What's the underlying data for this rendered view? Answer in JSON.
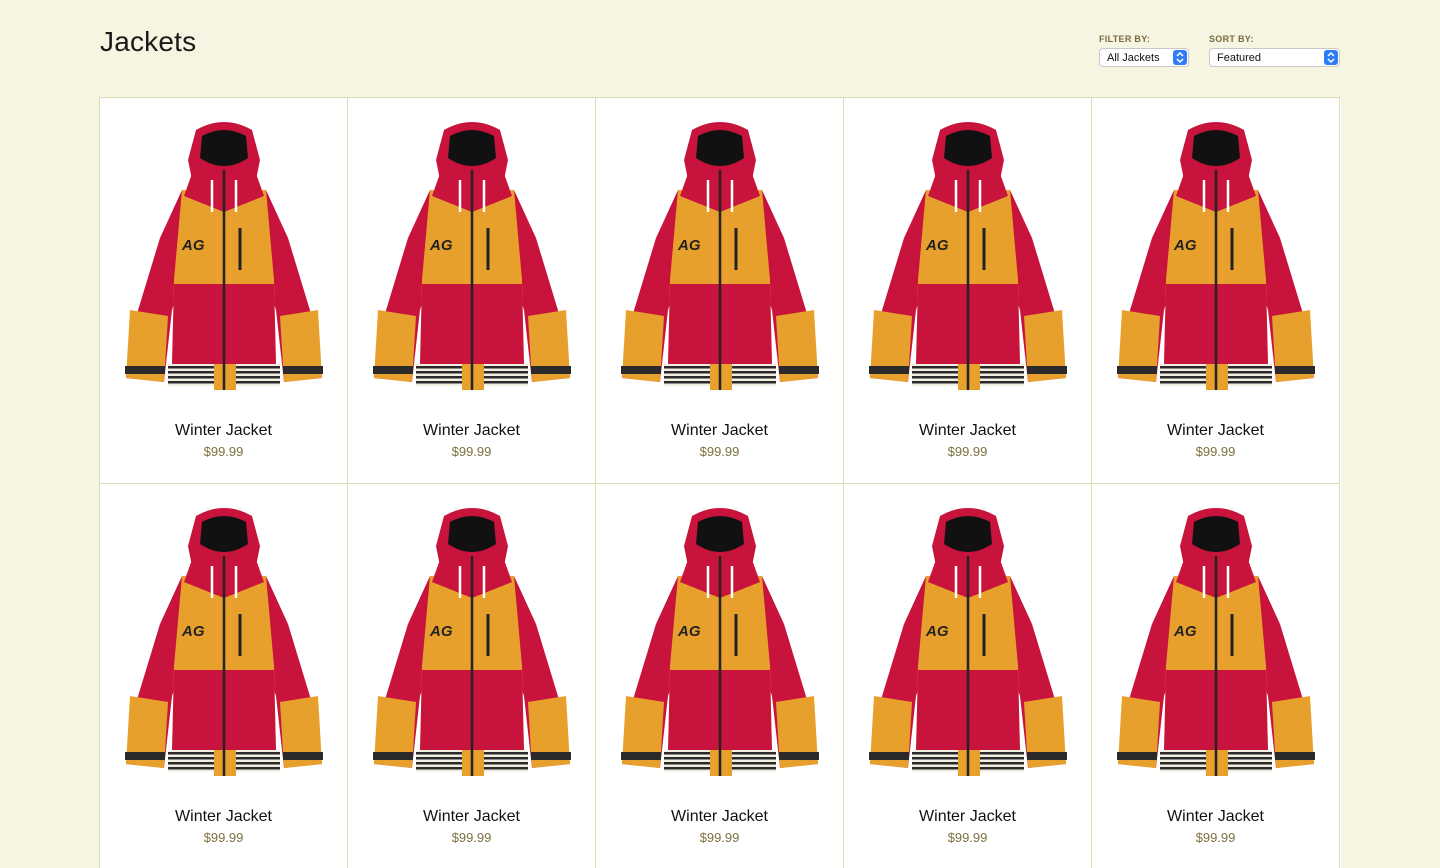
{
  "page": {
    "title": "Jackets"
  },
  "filter": {
    "label": "FILTER BY:",
    "selected": "All Jackets"
  },
  "sort": {
    "label": "SORT BY:",
    "selected": "Featured"
  },
  "products": [
    {
      "name": "Winter Jacket",
      "price": "$99.99",
      "image": "jacket-image"
    },
    {
      "name": "Winter Jacket",
      "price": "$99.99",
      "image": "jacket-image"
    },
    {
      "name": "Winter Jacket",
      "price": "$99.99",
      "image": "jacket-image"
    },
    {
      "name": "Winter Jacket",
      "price": "$99.99",
      "image": "jacket-image"
    },
    {
      "name": "Winter Jacket",
      "price": "$99.99",
      "image": "jacket-image"
    },
    {
      "name": "Winter Jacket",
      "price": "$99.99",
      "image": "jacket-image"
    },
    {
      "name": "Winter Jacket",
      "price": "$99.99",
      "image": "jacket-image"
    },
    {
      "name": "Winter Jacket",
      "price": "$99.99",
      "image": "jacket-image"
    },
    {
      "name": "Winter Jacket",
      "price": "$99.99",
      "image": "jacket-image"
    },
    {
      "name": "Winter Jacket",
      "price": "$99.99",
      "image": "jacket-image"
    }
  ],
  "colors": {
    "background": "#f5f5e2",
    "border": "#dcdcb6",
    "price": "#7d7040",
    "jacket_red": "#c8143c",
    "jacket_orange": "#e8a02c",
    "select_accent": "#2f7cf6"
  }
}
